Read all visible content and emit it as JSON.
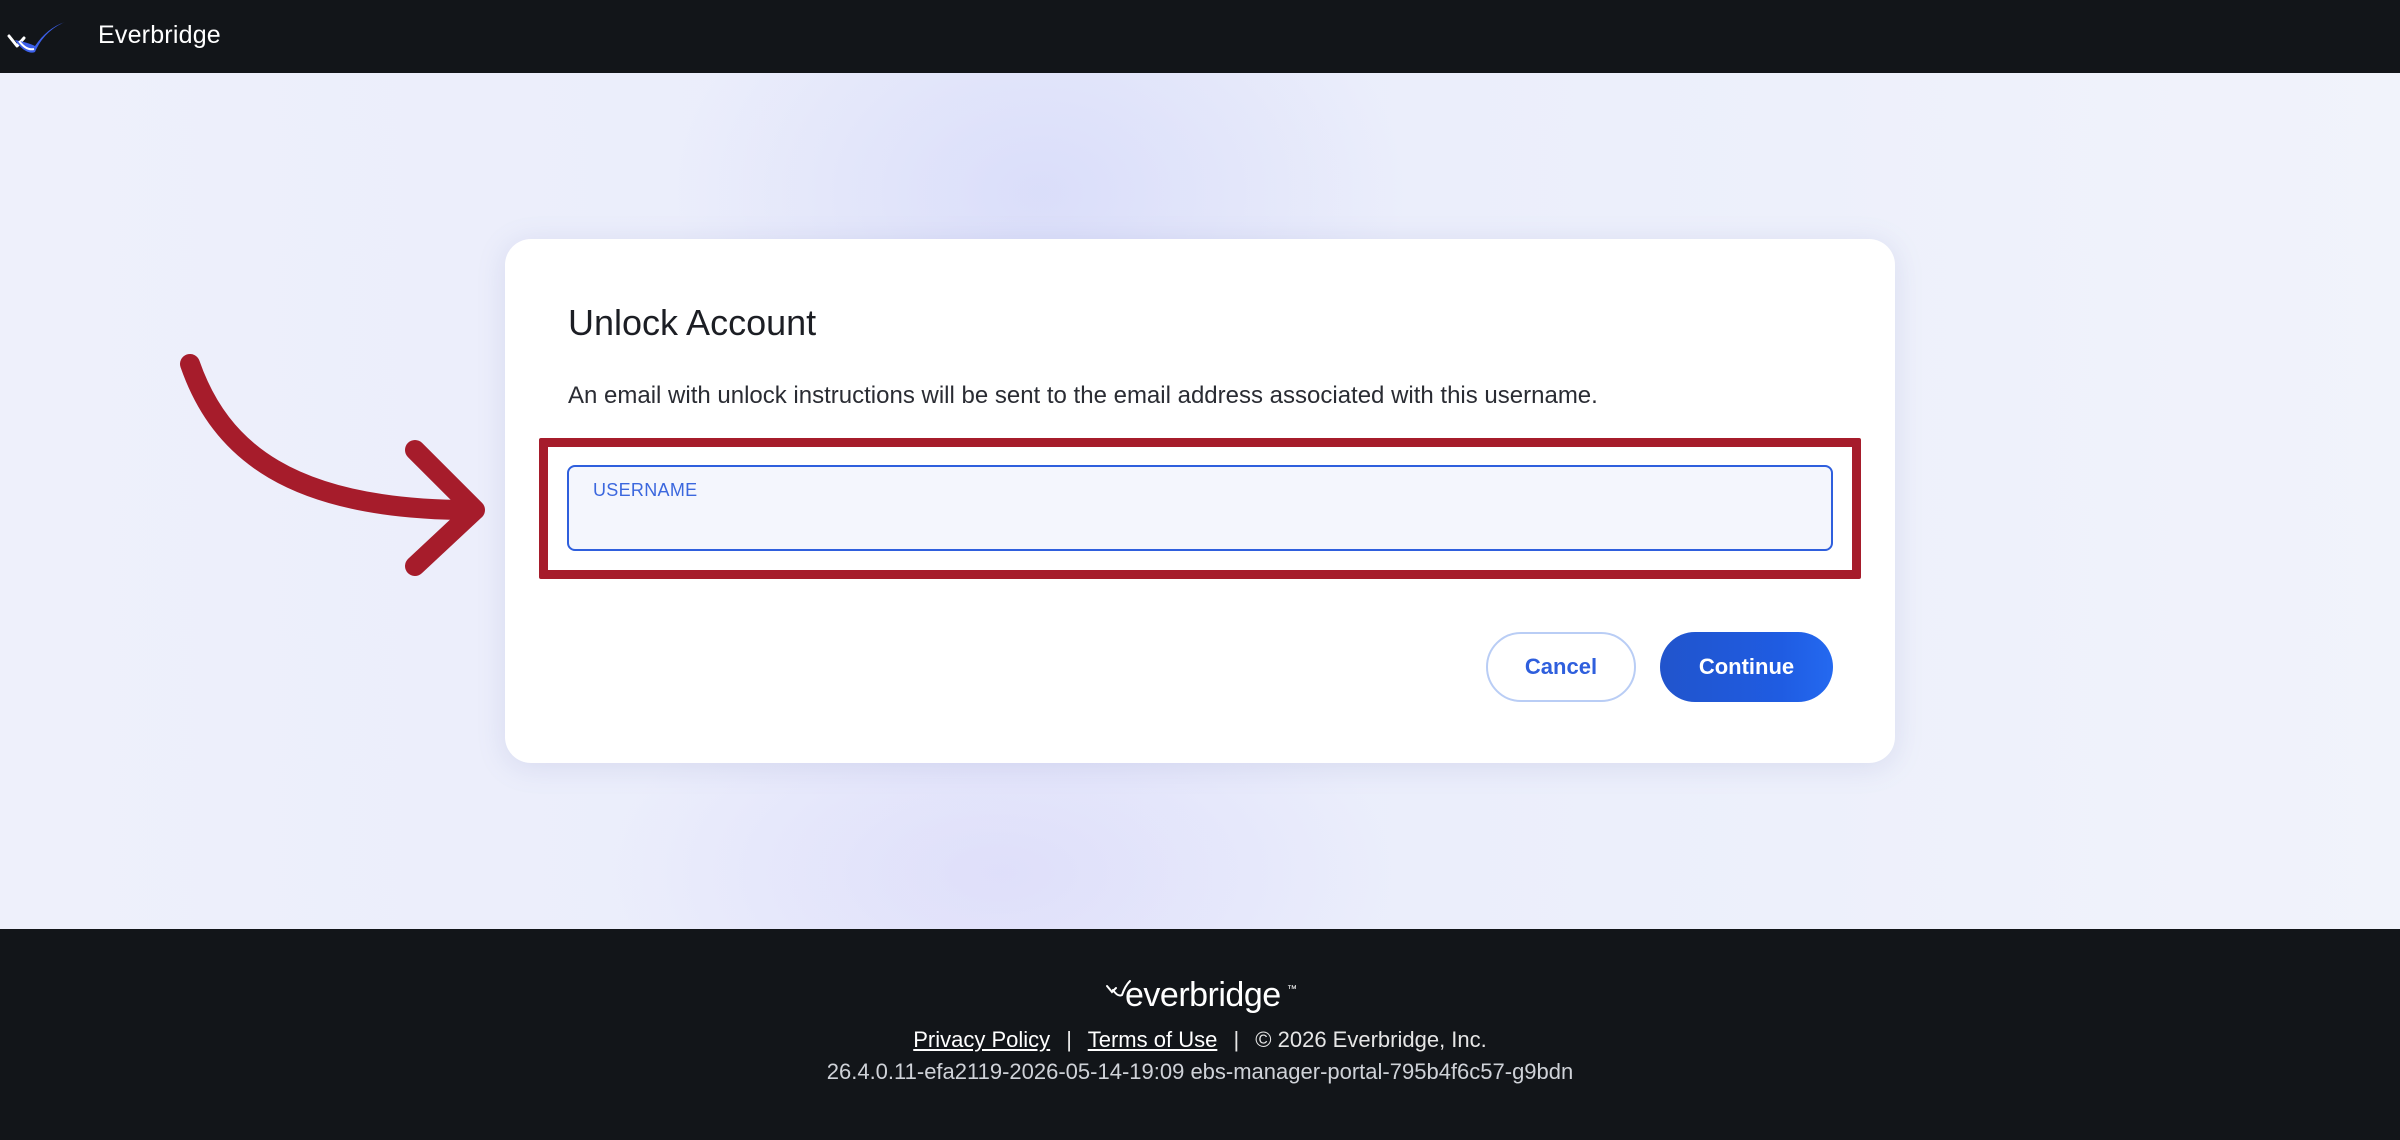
{
  "header": {
    "app_name": "Everbridge",
    "logo_icon": "everbridge-check-icon"
  },
  "card": {
    "title": "Unlock Account",
    "description": "An email with unlock instructions will be sent to the email address associated with this username.",
    "username": {
      "label": "USERNAME",
      "value": "",
      "value_obscured": true
    },
    "cancel_label": "Cancel",
    "continue_label": "Continue"
  },
  "annotation": {
    "arrow_icon": "curved-arrow-icon",
    "highlight_color": "#a61c2b"
  },
  "footer": {
    "logo_text": "everbridge",
    "logo_tm": "™",
    "privacy_label": "Privacy Policy",
    "separator": "|",
    "terms_label": "Terms of Use",
    "copyright": "©  2026 Everbridge, Inc.",
    "version": "26.4.0.11-efa2119-2026-05-14-19:09 ebs-manager-portal-795b4f6c57-g9bdn"
  },
  "colors": {
    "accent": "#2f5fdd",
    "topbar": "#121519",
    "annotation_red": "#a61c2b"
  }
}
